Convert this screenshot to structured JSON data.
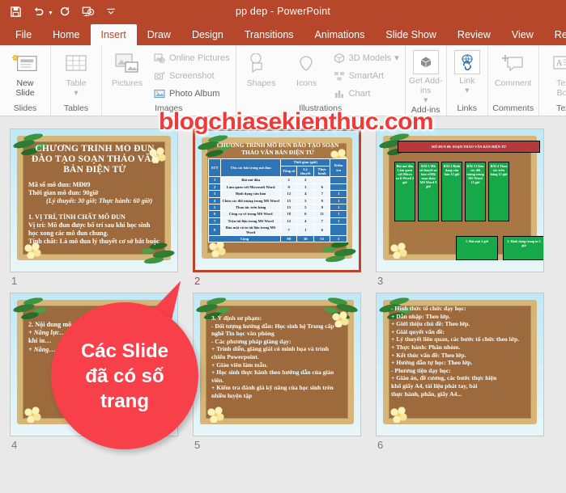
{
  "window": {
    "title": "pp dep  -  PowerPoint",
    "accent_color": "#b7472a",
    "qat": [
      {
        "name": "save-button",
        "label": "Save"
      },
      {
        "name": "undo-button",
        "label": "Undo"
      },
      {
        "name": "redo-button",
        "label": "Redo"
      },
      {
        "name": "start-presentation-button",
        "label": "Start From Beginning"
      },
      {
        "name": "customize-qat-button",
        "label": "Customize Quick Access Toolbar"
      }
    ]
  },
  "ribbon": {
    "tabs": [
      {
        "label": "File",
        "active": false
      },
      {
        "label": "Home",
        "active": false
      },
      {
        "label": "Insert",
        "active": true
      },
      {
        "label": "Draw",
        "active": false
      },
      {
        "label": "Design",
        "active": false
      },
      {
        "label": "Transitions",
        "active": false
      },
      {
        "label": "Animations",
        "active": false
      },
      {
        "label": "Slide Show",
        "active": false
      },
      {
        "label": "Review",
        "active": false
      },
      {
        "label": "View",
        "active": false
      },
      {
        "label": "Record",
        "active": false
      }
    ],
    "groups": {
      "slides": {
        "label": "Slides",
        "new_slide": "New\nSlide"
      },
      "tables": {
        "label": "Tables",
        "table": "Table"
      },
      "images": {
        "label": "Images",
        "pictures": "Pictures",
        "online_pictures": "Online Pictures",
        "screenshot": "Screenshot",
        "photo_album": "Photo Album"
      },
      "illustrations": {
        "label": "Illustrations",
        "shapes": "Shapes",
        "icons": "Icons",
        "models_3d": "3D Models",
        "smartart": "SmartArt",
        "chart": "Chart"
      },
      "addins": {
        "label": "Add-ins",
        "get_addins": "Get Add-\nins"
      },
      "links": {
        "label": "Links",
        "link": "Link"
      },
      "comments": {
        "label": "Comments",
        "comment": "Comment"
      },
      "text": {
        "label": "Text",
        "text_box": "Text\nBox"
      }
    }
  },
  "watermark": {
    "text": "blogchiasekienthuc.com",
    "color": "#ef3a3a"
  },
  "callout": {
    "text_lines": [
      "Các Slide",
      "đã có số",
      "trang"
    ],
    "color": "#f8404a"
  },
  "slides": [
    {
      "number": "1",
      "selected": false,
      "type": "text",
      "title": "CHƯƠNG TRÌNH MÔ ĐUN ĐÀO TẠO SOẠN THẢO VĂN BẢN ĐIỆN TỬ",
      "lines": [
        {
          "text": "Mã số mô đun: MĐ09",
          "style": "normal"
        },
        {
          "text": "Thời gian mô đun: 90giờ",
          "style": "normal"
        },
        {
          "text": "(Lý thuyết: 30 giờ; Thực hành: 60 giờ)",
          "style": "italic-indent"
        },
        {
          "text": "",
          "style": "gap"
        },
        {
          "text": "1. VỊ TRÍ, TÍNH CHẤT MÔ ĐUN",
          "style": "normal"
        },
        {
          "text": "Vị trí: Mô đun được bố trí sau khi học sinh học xong các mô đun chung.",
          "style": "normal"
        },
        {
          "text": "Tính chất: Là mô đun lý thuyết cơ sở bắt buộc",
          "style": "normal"
        }
      ]
    },
    {
      "number": "2",
      "selected": true,
      "type": "table",
      "title": "CHƯƠNG TRÌNH MÔ ĐUN ĐÀO TẠO SOẠN THẢO VĂN BẢN ĐIỆN TỬ",
      "table": {
        "header_group": "Thời gian (giờ)",
        "headers": [
          "STT",
          "Tên các bài trong mô đun",
          "Tổng số",
          "Lý thuyết",
          "Thực hành",
          "Kiểm tra"
        ],
        "rows": [
          {
            "idx": "1",
            "name": "Bài mở đầu",
            "total": "2",
            "theory": "2",
            "practice": "",
            "test": ""
          },
          {
            "idx": "2",
            "name": "Làm quen với Microsoft Word",
            "total": "9",
            "theory": "3",
            "practice": "6",
            "test": ""
          },
          {
            "idx": "3",
            "name": "Định dạng văn bản",
            "total": "12",
            "theory": "4",
            "practice": "7",
            "test": "1"
          },
          {
            "idx": "4",
            "name": "Chèn các đối tượng trong MS Word",
            "total": "15",
            "theory": "5",
            "practice": "9",
            "test": "1"
          },
          {
            "idx": "5",
            "name": "Thao tác trên bảng",
            "total": "15",
            "theory": "5",
            "practice": "9",
            "test": "1"
          },
          {
            "idx": "6",
            "name": "Công cụ vẽ trong MS Word",
            "total": "18",
            "theory": "6",
            "practice": "11",
            "test": "1"
          },
          {
            "idx": "7",
            "name": "Trộn tài liệu trong MS Word",
            "total": "12",
            "theory": "4",
            "practice": "7",
            "test": "1"
          },
          {
            "idx": "8",
            "name": "Bảo mật và in tài liệu trong MS Word",
            "total": "7",
            "theory": "1",
            "practice": "6",
            "test": ""
          }
        ],
        "total_row": {
          "label": "Cộng",
          "total": "90",
          "theory": "30",
          "practice": "55",
          "test": "5"
        }
      }
    },
    {
      "number": "3",
      "selected": false,
      "type": "diagram",
      "diagram": {
        "top_box": "MÔ ĐUN 09: SOẠN THẢO VĂN BẢN ĐIỆN TỬ",
        "boxes": [
          "Bài mở đầu Làm quen với Micro so ft Word 2 giờ",
          "BÀI 1 Mã số thuyết sư bản vềMã soạn thảo MS Word 9 giờ",
          "BÀI 2 Định dạng văn bản 12 giờ",
          "BÀI 3 Chèn các đối tượng trong MS Word 15 giờ",
          "BÀI 4 Thao tác trên bảng 15 giờ"
        ],
        "sub_boxes": [
          "1. Bài một 2 giờ",
          "2. Định dạng trang in 2 giờ"
        ]
      }
    },
    {
      "number": "4",
      "selected": false,
      "type": "text",
      "title": "",
      "lines": [
        {
          "text": "2. Nội dung mô đun",
          "style": "normal"
        },
        {
          "text": "+ Năng lực…",
          "style": "italic"
        },
        {
          "text": "khi in…",
          "style": "normal"
        },
        {
          "text": "+ Năng…",
          "style": "italic"
        }
      ]
    },
    {
      "number": "5",
      "selected": false,
      "type": "text",
      "title": "",
      "lines": [
        {
          "text": "3. Ý định sư phạm:",
          "style": "normal"
        },
        {
          "text": "- Đối tượng hướng dẫn: Học sinh hệ Trung cấp nghề Tin học văn phòng",
          "style": "normal"
        },
        {
          "text": "- Các phương pháp giảng dạy:",
          "style": "normal"
        },
        {
          "text": "+ Trình diễn, giảng giải có minh họa và trình chiếu Powerpoint.",
          "style": "normal"
        },
        {
          "text": "+ Giáo viên làm mẫu.",
          "style": "normal"
        },
        {
          "text": "+ Học sinh thực hành theo hướng dẫn của giáo viên.",
          "style": "normal"
        },
        {
          "text": "+ Kiểm tra đánh giá kỹ năng của học sinh trên nhiều luyện tập",
          "style": "normal"
        }
      ]
    },
    {
      "number": "6",
      "selected": false,
      "type": "text",
      "title": "",
      "lines": [
        {
          "text": "- Hình thức tổ chức dạy học:",
          "style": "normal"
        },
        {
          "text": "+ Dẫn nhập: Theo lớp.",
          "style": "normal"
        },
        {
          "text": "+ Giới thiệu chủ đề: Theo lớp.",
          "style": "normal"
        },
        {
          "text": "+ Giải quyết vấn đề:",
          "style": "normal"
        },
        {
          "text": "+ Lý thuyết liên quan, các bước tổ chức theo lớp.",
          "style": "normal"
        },
        {
          "text": "+ Thực hành: Phân nhóm.",
          "style": "normal"
        },
        {
          "text": "+ Kết thúc vấn đề: Theo lớp.",
          "style": "normal"
        },
        {
          "text": "+ Hướng dẫn tự học: Theo lớp.",
          "style": "normal"
        },
        {
          "text": "- Phương tiện dạy học:",
          "style": "normal"
        },
        {
          "text": "+ Giáo án, đề cương, các bước thực hiện",
          "style": "normal"
        },
        {
          "text": "khổ giấy A4, tài liệu phát tay, bài",
          "style": "normal"
        },
        {
          "text": "thực hành, phấn, giấy A4...",
          "style": "normal"
        }
      ]
    }
  ]
}
